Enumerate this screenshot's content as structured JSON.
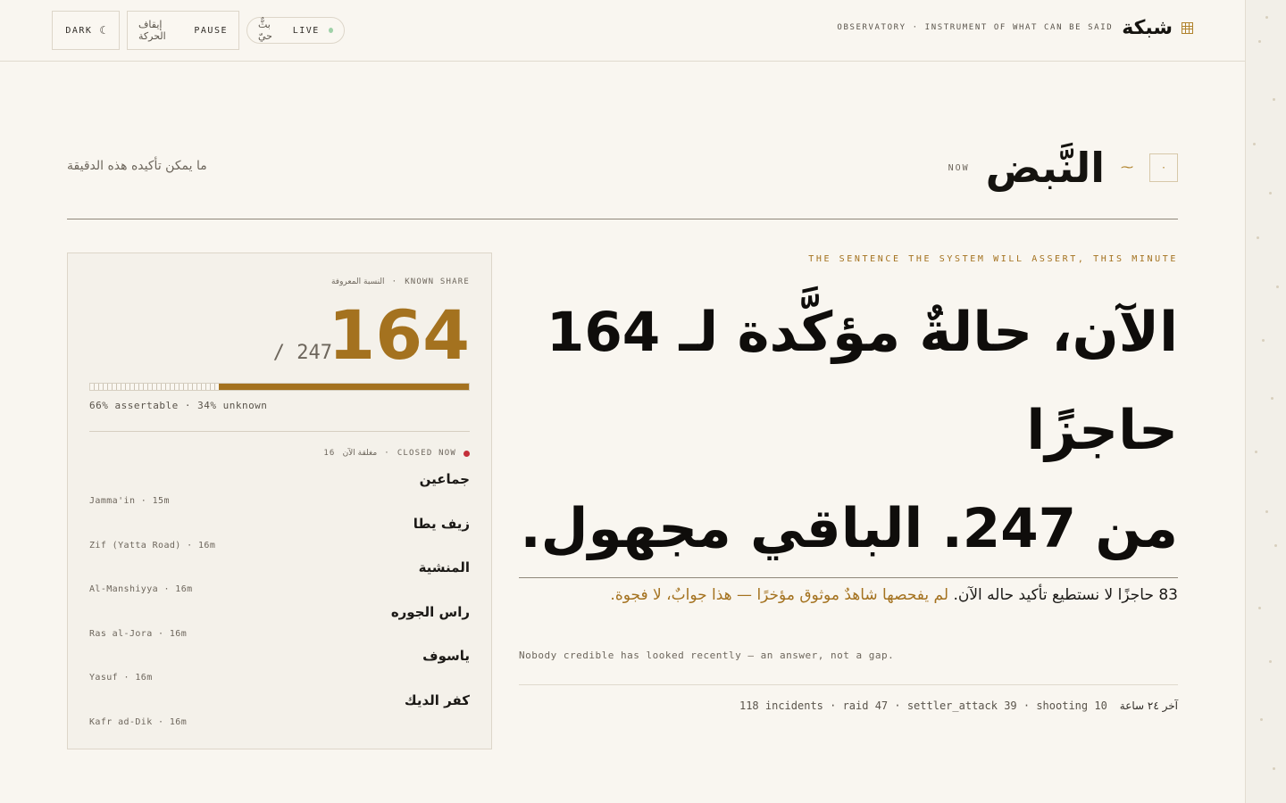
{
  "header": {
    "controls": {
      "dark_label": "DARK",
      "moon_glyph": "☾",
      "pause_ar": "إيقاف الحركة",
      "pause_label": "PAUSE",
      "live_ar": "بثٌّ حيّ",
      "live_label": "LIVE"
    },
    "brand": {
      "subtitle": "OBSERVATORY · INSTRUMENT OF WHAT CAN BE SAID",
      "name": "شبكة",
      "icon": "grid-icon"
    }
  },
  "section": {
    "subtitle": "ما يمكن تأكيده هذه الدقيقة",
    "now_label": "NOW",
    "title": "النَّبض",
    "pulse_glyph": "⁓",
    "counter": "·"
  },
  "card": {
    "share_label_en": "KNOWN SHARE",
    "share_sep": "·",
    "share_label_ar": "النسبة المعروفة",
    "known": "164",
    "total": "/ 247",
    "known_fraction": 0.66,
    "stats": "66% assertable · 34% unknown",
    "closed_label_en": "CLOSED NOW",
    "closed_sep": "·",
    "closed_label_ar": "مغلقة الآن",
    "closed_count": "16",
    "checkpoints": [
      {
        "ar": "جماعين",
        "en": "Jamma'in · 15m"
      },
      {
        "ar": "زيف يطا",
        "en": "Zif (Yatta Road) · 16m"
      },
      {
        "ar": "المنشية",
        "en": "Al-Manshiyya · 16m"
      },
      {
        "ar": "راس الجوره",
        "en": "Ras al-Jora · 16m"
      },
      {
        "ar": "ياسوف",
        "en": "Yasuf · 16m"
      },
      {
        "ar": "كفر الديك",
        "en": "Kafr ad-Dik · 16m"
      }
    ]
  },
  "assertion": {
    "tag": "THE SENTENCE THE SYSTEM WILL ASSERT, THIS MINUTE",
    "line1": "الآن، حالةٌ مؤكَّدة لـ 164",
    "line2": "حاجزًا",
    "line3": "من 247. الباقي مجهول.",
    "detail_plain": "83 حاجزًا لا نستطيع تأكيد حاله الآن.",
    "detail_gold": "لم يفحصها شاهدٌ موثوق مؤخرًا — هذا جوابٌ، لا فجوة.",
    "note": "Nobody credible has looked recently — an answer, not a gap.",
    "footer_stats": "118 incidents · raid 47 · settler_attack 39 · shooting 10",
    "footer_ar": "آخر ٢٤ ساعة"
  },
  "colors": {
    "accent": "#a4721f",
    "background": "#f9f6f0",
    "closed_red": "#c4303a",
    "live_green": "#9fd1a8"
  }
}
